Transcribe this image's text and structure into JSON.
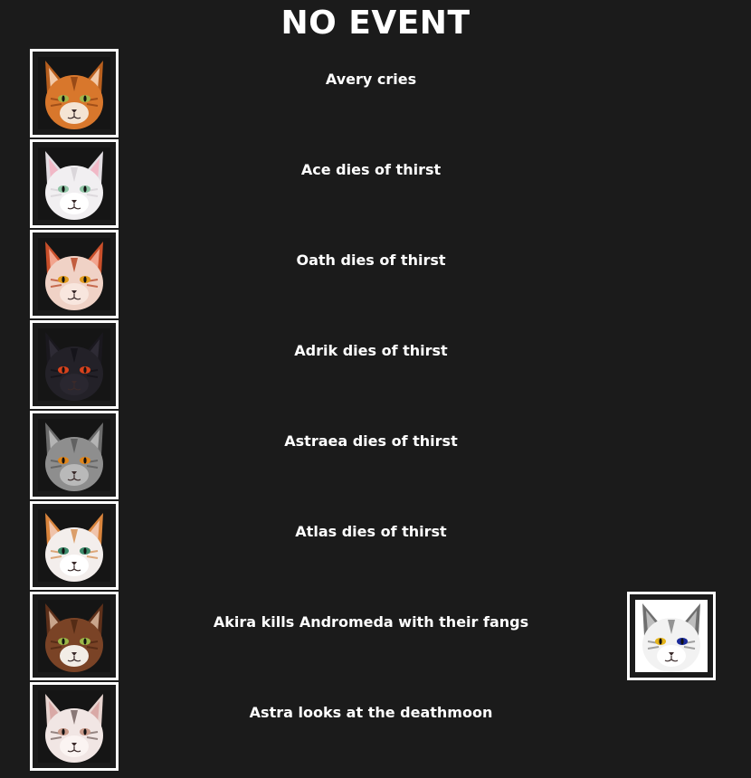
{
  "title": "NO EVENT",
  "events": [
    {
      "text": "Avery cries",
      "cat": {
        "name": "Avery",
        "fur": "#d8772c",
        "ear": "#b85f1e",
        "inner": "#f2c9a8",
        "muzzle": "#f4e4d4",
        "eye": "#9fb54a",
        "stripe": "#8a3f12",
        "bg": "#151515"
      }
    },
    {
      "text": "Ace dies of thirst",
      "cat": {
        "name": "Ace",
        "fur": "#f1eff1",
        "ear": "#e2dde2",
        "inner": "#f1b8c6",
        "muzzle": "#ffffff",
        "eye": "#8fc4a5",
        "stripe": "#d5d0d5",
        "bg": "#151515"
      }
    },
    {
      "text": "Oath dies of thirst",
      "cat": {
        "name": "Oath",
        "fur": "#f0d2c6",
        "ear": "#c94f2a",
        "inner": "#f2a48e",
        "muzzle": "#f8e6de",
        "eye": "#e09b1d",
        "stripe": "#b6401d",
        "bg": "#151515"
      }
    },
    {
      "text": "Adrik dies of thirst",
      "cat": {
        "name": "Adrik",
        "fur": "#232128",
        "ear": "#1a181e",
        "inner": "#2e2b35",
        "muzzle": "#2a2730",
        "eye": "#d8421c",
        "stripe": "#121116",
        "bg": "#151515"
      }
    },
    {
      "text": "Astraea dies of thirst",
      "cat": {
        "name": "Astraea",
        "fur": "#8e8e8e",
        "ear": "#6c6c6c",
        "inner": "#b4b4b4",
        "muzzle": "#b9b9b9",
        "eye": "#e0861c",
        "stripe": "#565656",
        "bg": "#151515"
      }
    },
    {
      "text": "Atlas dies of thirst",
      "cat": {
        "name": "Atlas",
        "fur": "#f3eeec",
        "ear": "#d9843c",
        "inner": "#f0c3aa",
        "muzzle": "#ffffff",
        "eye": "#3c8a6a",
        "stripe": "#d48a4a",
        "bg": "#151515"
      }
    },
    {
      "text": "Akira kills Andromeda with their fangs",
      "cat": {
        "name": "Akira",
        "fur": "#7a4326",
        "ear": "#5e301a",
        "inner": "#c9a58c",
        "muzzle": "#f2ede6",
        "eye": "#9bb848",
        "stripe": "#4b2512",
        "bg": "#151515"
      },
      "victim": {
        "name": "Andromeda",
        "fur": "#f2f2f2",
        "ear": "#6f6f6f",
        "inner": "#bdbdbd",
        "muzzle": "#ffffff",
        "eye": "#e5b41a",
        "eye2": "#1a2a9a",
        "stripe": "#7c7c7c",
        "bg": "#ffffff"
      }
    },
    {
      "text": "Astra looks at the deathmoon",
      "cat": {
        "name": "Astra",
        "fur": "#f1e6e4",
        "ear": "#e7d4d0",
        "inner": "#d9a9a6",
        "muzzle": "#fbf4f2",
        "eye": "#c99a8a",
        "stripe": "#6f5d5a",
        "bg": "#151515"
      }
    }
  ]
}
